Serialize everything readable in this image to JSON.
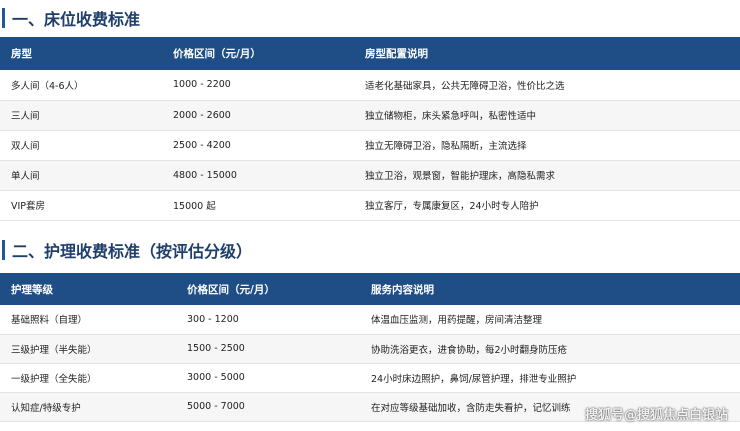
{
  "section1": {
    "title": "一、床位收费标准",
    "headers": [
      "房型",
      "价格区间（元/月）",
      "房型配置说明"
    ],
    "rows": [
      [
        "多人间（4-6人）",
        "1000 - 2200",
        "适老化基础家具，公共无障碍卫浴，性价比之选"
      ],
      [
        "三人间",
        "2000 - 2600",
        "独立储物柜，床头紧急呼叫，私密性适中"
      ],
      [
        "双人间",
        "2500 - 4200",
        "独立无障碍卫浴，隐私隔断，主流选择"
      ],
      [
        "单人间",
        "4800 - 15000",
        "独立卫浴，观景窗，智能护理床，高隐私需求"
      ],
      [
        "VIP套房",
        "15000 起",
        "独立客厅，专属康复区，24小时专人陪护"
      ]
    ]
  },
  "section2": {
    "title": "二、护理收费标准（按评估分级）",
    "headers": [
      "护理等级",
      "价格区间（元/月）",
      "服务内容说明"
    ],
    "rows": [
      [
        "基础照料（自理）",
        "300 - 1200",
        "体温血压监测，用药提醒，房间清洁整理"
      ],
      [
        "三级护理（半失能）",
        "1500 - 2500",
        "协助洗浴更衣，进食协助，每2小时翻身防压疮"
      ],
      [
        "一级护理（全失能）",
        "3000 - 5000",
        "24小时床边照护，鼻饲/尿管护理，排泄专业照护"
      ],
      [
        "认知症/特级专护",
        "5000 - 7000",
        "在对应等级基础加收，含防走失看护，记忆训练"
      ]
    ]
  },
  "watermark": "搜狐号@搜狐焦点白银站"
}
